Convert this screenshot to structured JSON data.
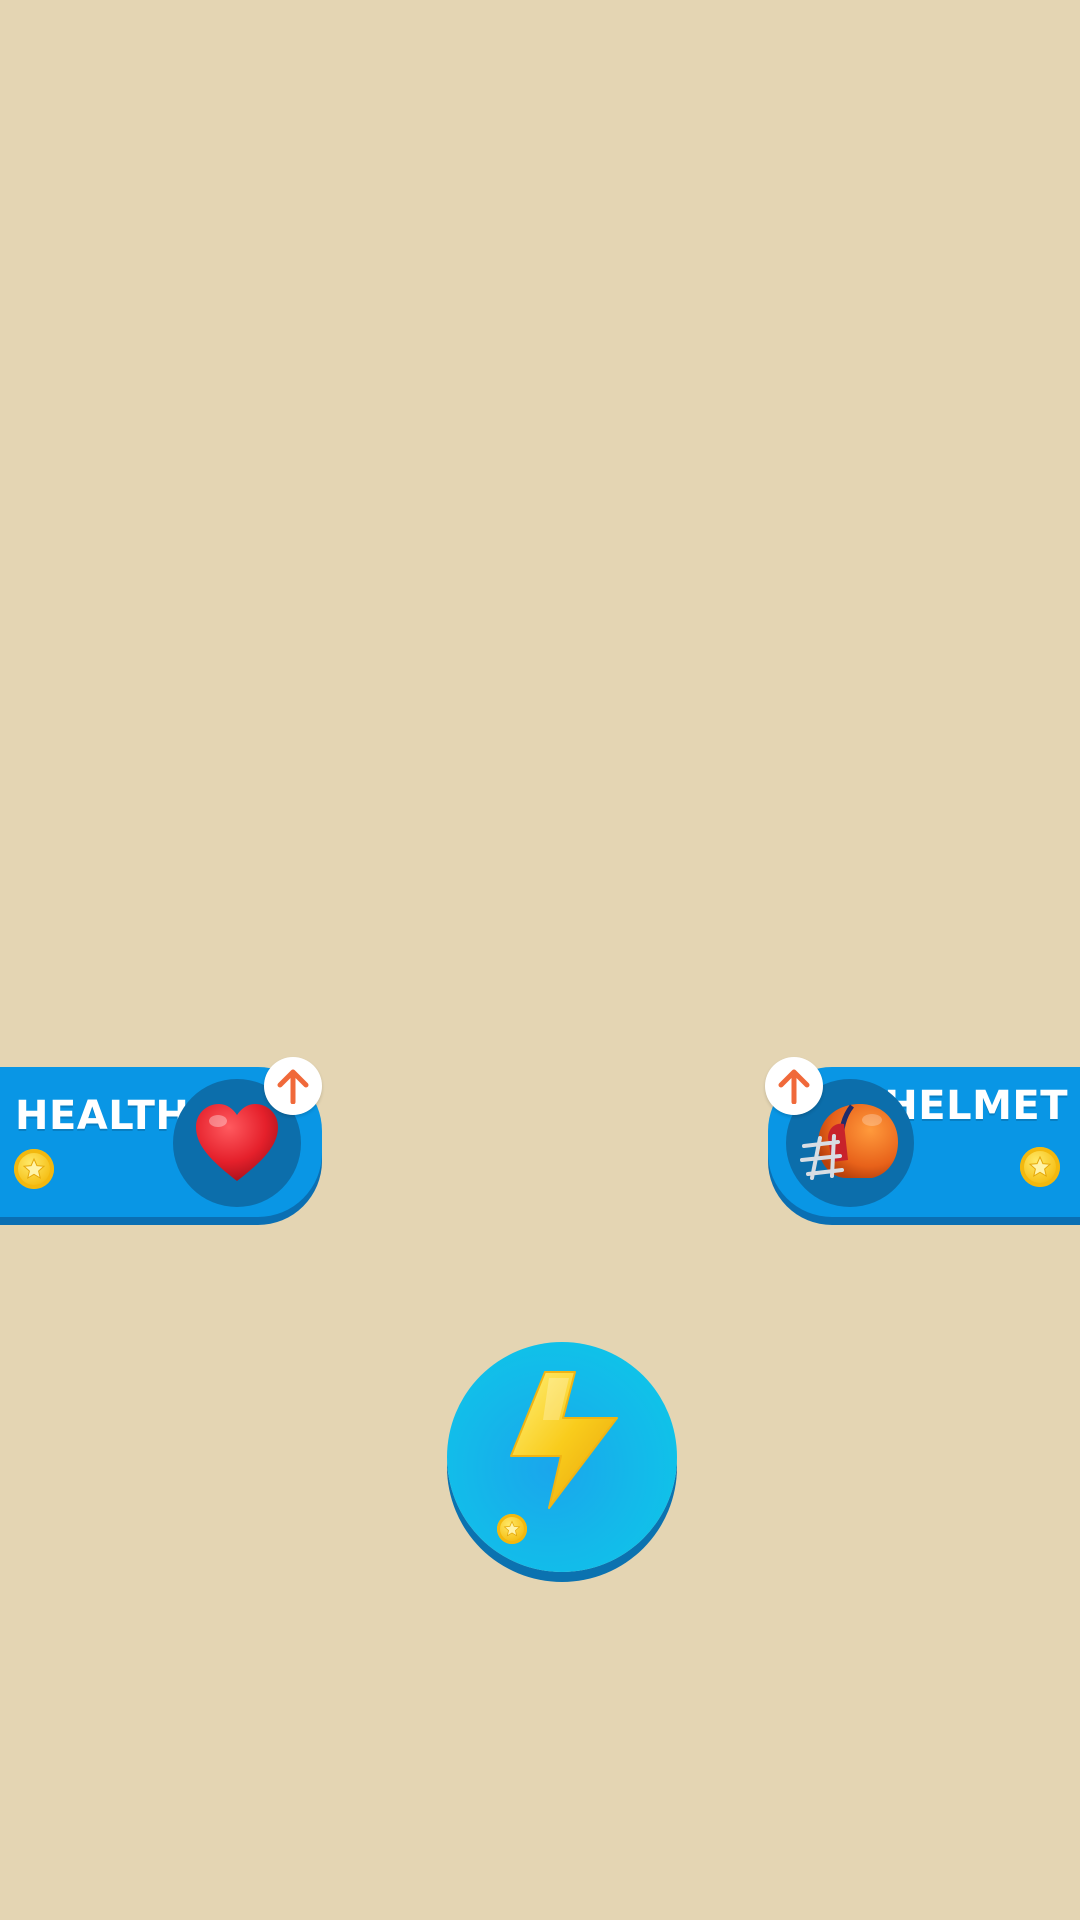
{
  "upgrades": [
    {
      "title": "HEALTH",
      "icon": "heart-icon"
    },
    {
      "title": "HELMET",
      "icon": "helmet-icon"
    }
  ],
  "power_button": {
    "icon": "lightning-bolt-icon"
  },
  "colors": {
    "background": "#e4d5b3",
    "card": "#0996e5",
    "card_shadow": "#0a6fb3",
    "icon_well": "#0c6eab",
    "arrow": "#f0693a",
    "coin": "#f6c21c"
  }
}
